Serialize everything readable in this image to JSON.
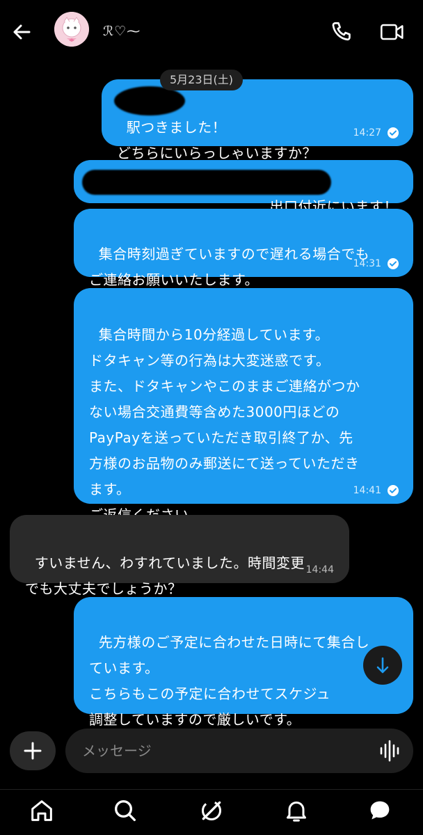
{
  "header": {
    "contact_name": "ℛ♡︎⁓"
  },
  "date_separator": "5月23日(土)",
  "messages": [
    {
      "text": "駅つきました！\nどちらにいらっしゃいますか？",
      "time": "14:27"
    },
    {
      "text": "出口付近にいます！",
      "time": ""
    },
    {
      "text": "集合時刻過ぎていますので遅れる場合でも\nご連絡お願いいたします。",
      "time": "14:31"
    },
    {
      "text": "集合時間から10分経過しています。\nドタキャン等の行為は大変迷惑です。\nまた、ドタキャンやこのままご連絡がつか\nない場合交通費等含めた3000円ほどの\nPayPayを送っていただき取引終了か、先\n方様のお品物のみ郵送にて送っていただき\nます。\nご返信ください。",
      "time": "14:41"
    },
    {
      "text": "すいません、わすれていました。時間変更\nでも大丈夫でしょうか？",
      "time": "14:44"
    },
    {
      "text": "先方様のご予定に合わせた日時にて集合し\nています。\nこちらもこの予定に合わせてスケジュ\n調整していますので厳しいです。",
      "time": ""
    }
  ],
  "composer": {
    "placeholder": "メッセージ"
  },
  "colors": {
    "outgoing_bubble": "#1d9bf0",
    "incoming_bubble": "#2a2a2a",
    "background": "#000000"
  }
}
